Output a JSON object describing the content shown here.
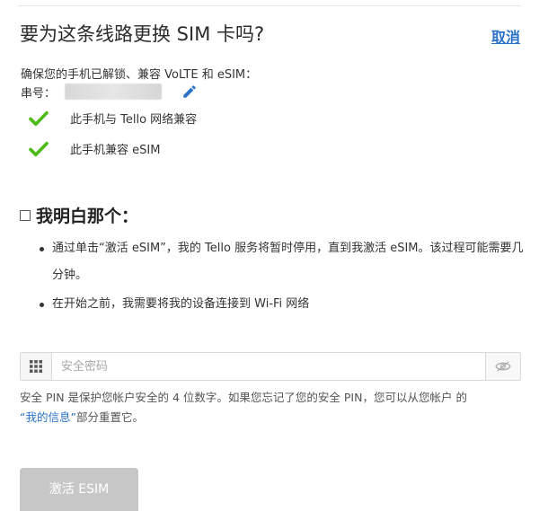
{
  "header": {
    "title": "要为这条线路更换 SIM 卡吗?",
    "cancel_label": "取消"
  },
  "device": {
    "ensure_text": "确保您的手机已解锁、兼容 VoLTE 和 eSIM：",
    "serial_label": "串号：",
    "checks": [
      {
        "icon": "check-icon",
        "text": "此手机与 Tello 网络兼容"
      },
      {
        "icon": "check-icon",
        "text": "此手机兼容 eSIM"
      }
    ]
  },
  "acknowledge": {
    "title": "我明白那个：",
    "checked": false,
    "bullets": [
      "通过单击“激活 eSIM”，我的 Tello 服务将暂时停用，直到我激活 eSIM。该过程可能需要几分钟。",
      "在开始之前，我需要将我的设备连接到 Wi-Fi 网络"
    ]
  },
  "pin": {
    "placeholder": "安全密码",
    "value": "",
    "help_text": "安全 PIN 是保护您帐户安全的 4 位数字。如果您忘记了您的安全 PIN，您可以从您帐户 的",
    "help_link": "“我的信息”",
    "help_suffix": "部分重置它。"
  },
  "actions": {
    "activate_label": "激活 ESIM"
  },
  "colors": {
    "accent": "#2a72c8",
    "check": "#4cbb17",
    "disabled_button": "#c7c7c7"
  }
}
